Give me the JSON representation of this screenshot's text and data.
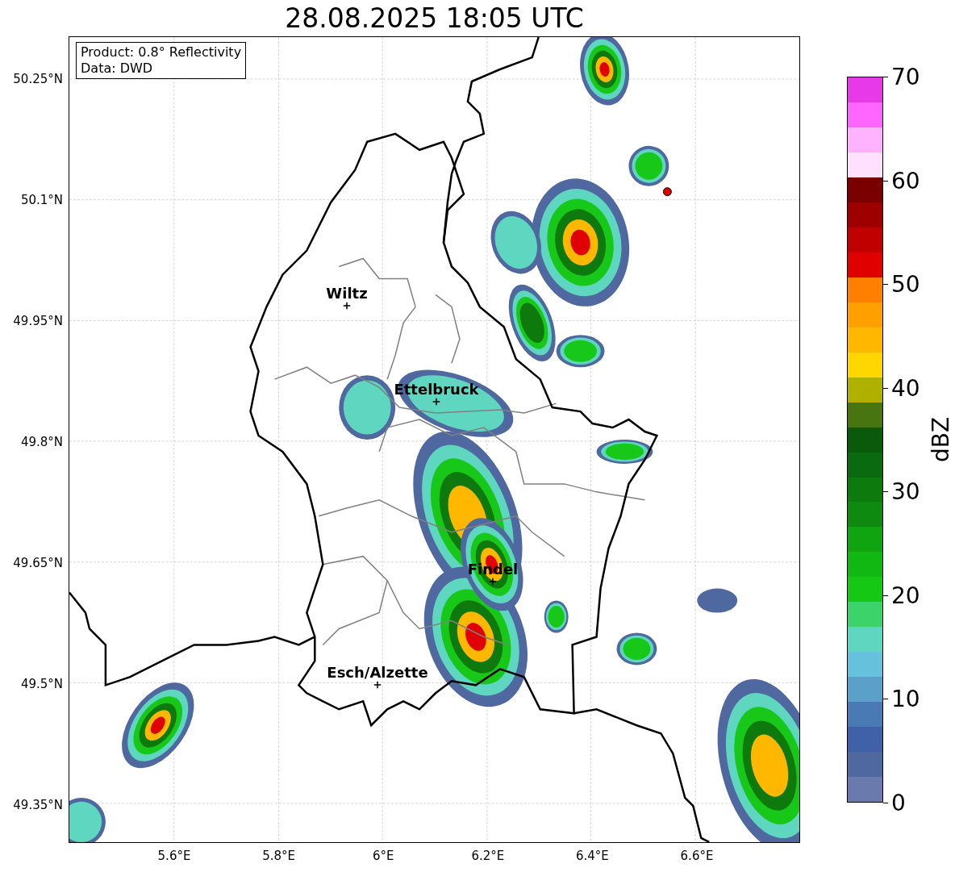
{
  "title": "28.08.2025 18:05 UTC",
  "annotation": [
    "Product: 0.8° Reflectivity",
    "Data: DWD"
  ],
  "map": {
    "lat_labels": [
      "50.25°N",
      "50.1°N",
      "49.95°N",
      "49.8°N",
      "49.65°N",
      "49.5°N",
      "49.35°N"
    ],
    "lon_labels": [
      "5.6°E",
      "5.8°E",
      "6°E",
      "6.2°E",
      "6.4°E",
      "6.6°E"
    ],
    "cities": [
      {
        "name": "Wiltz"
      },
      {
        "name": "Ettelbruck"
      },
      {
        "name": "Findel"
      },
      {
        "name": "Esch/Alzette"
      }
    ]
  },
  "colorbar": {
    "label": "dBZ",
    "ticks": [
      "70",
      "60",
      "50",
      "40",
      "30",
      "20",
      "10",
      "0"
    ],
    "segments": [
      {
        "color": "#e839e8"
      },
      {
        "color": "#ff66ff"
      },
      {
        "color": "#ffb3ff"
      },
      {
        "color": "#ffe0ff"
      },
      {
        "color": "#7a0000"
      },
      {
        "color": "#9e0000"
      },
      {
        "color": "#c00000"
      },
      {
        "color": "#e00000"
      },
      {
        "color": "#ff7f00"
      },
      {
        "color": "#ff9f00"
      },
      {
        "color": "#ffb700"
      },
      {
        "color": "#ffd700"
      },
      {
        "color": "#b0b000"
      },
      {
        "color": "#487510"
      },
      {
        "color": "#0b5a0b"
      },
      {
        "color": "#0a6a10"
      },
      {
        "color": "#0c7a0c"
      },
      {
        "color": "#0f8a10"
      },
      {
        "color": "#10a410"
      },
      {
        "color": "#12b812"
      },
      {
        "color": "#14c814"
      },
      {
        "color": "#3cd46a"
      },
      {
        "color": "#5fd6c0"
      },
      {
        "color": "#66c1dc"
      },
      {
        "color": "#5ba0c8"
      },
      {
        "color": "#4a7ab4"
      },
      {
        "color": "#4060a8"
      },
      {
        "color": "#5068a0"
      },
      {
        "color": "#6a7aac"
      }
    ]
  }
}
